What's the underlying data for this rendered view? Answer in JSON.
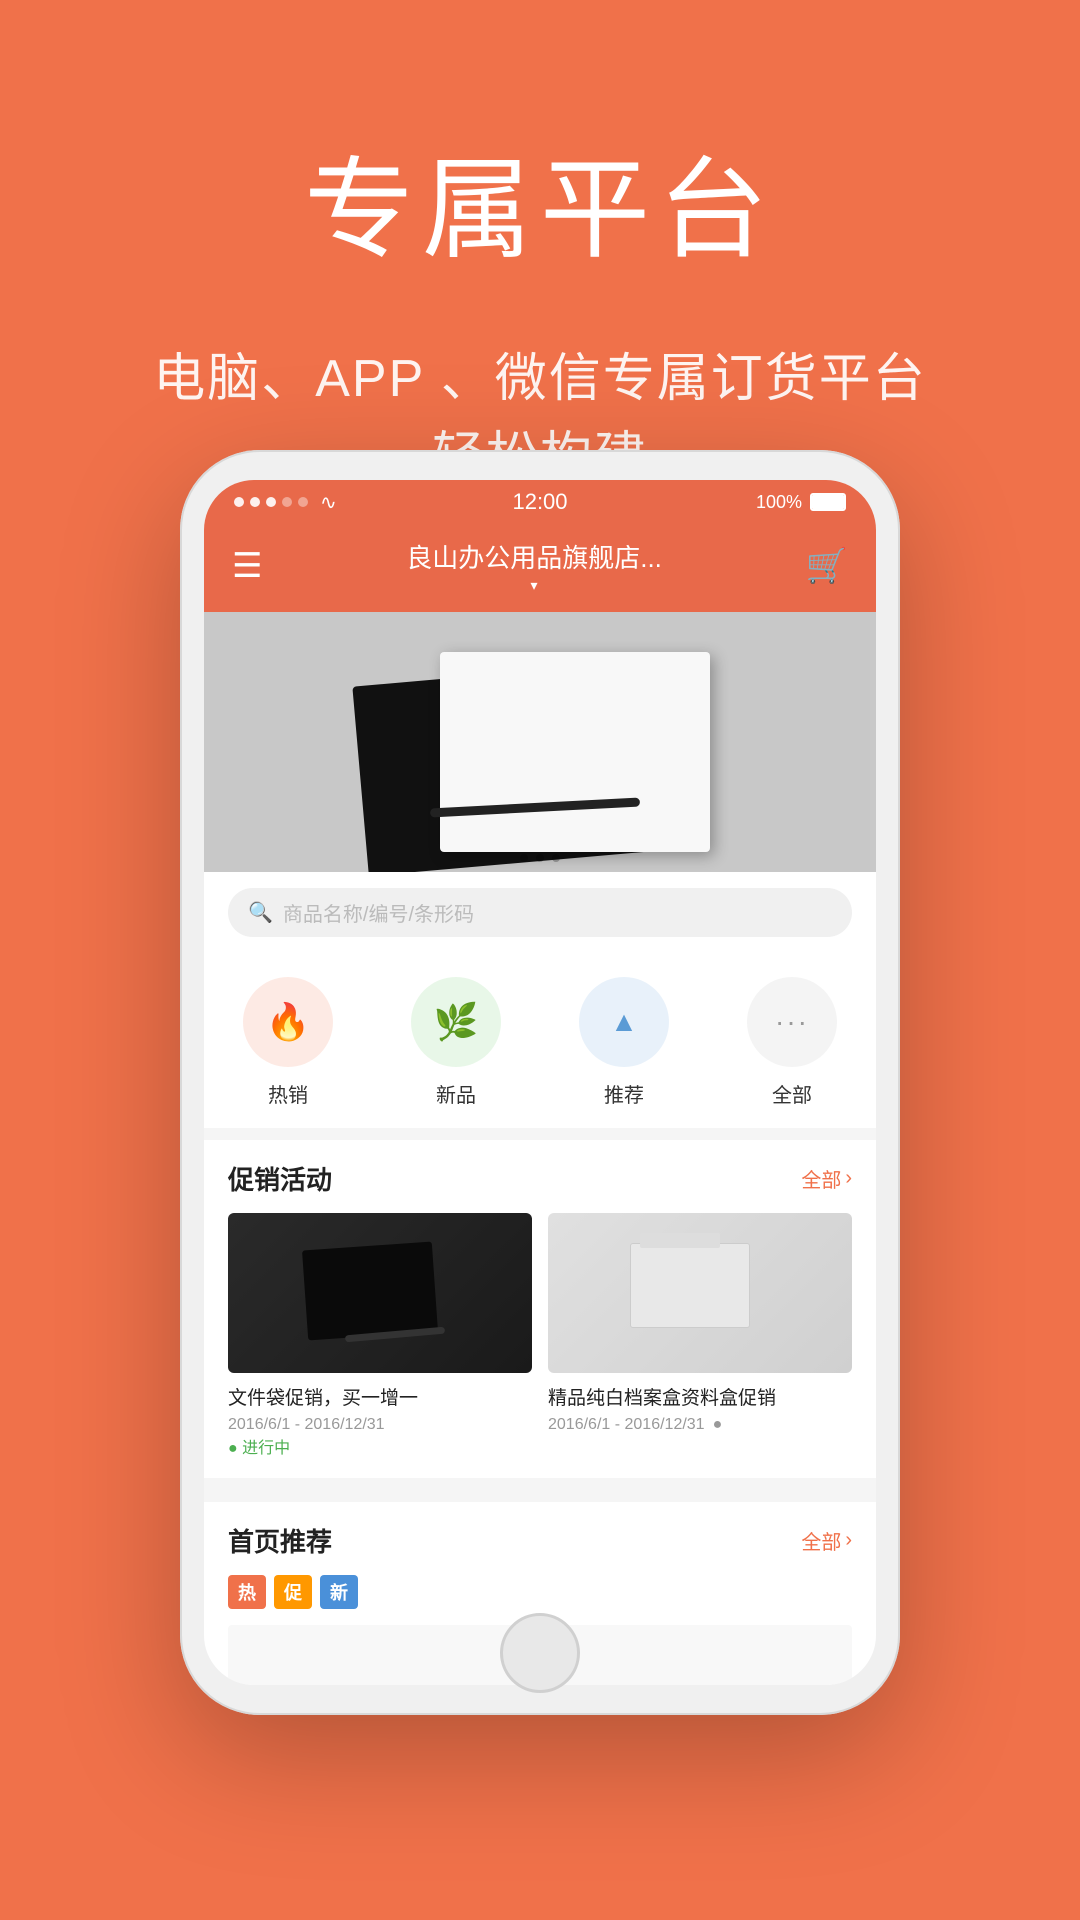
{
  "hero": {
    "title": "专属平台",
    "subtitle_line1": "电脑、APP 、微信专属订货平台",
    "subtitle_line2": "轻松构建"
  },
  "phone": {
    "status_bar": {
      "time": "12:00",
      "battery": "100%",
      "dots": [
        "filled",
        "filled",
        "filled",
        "empty",
        "empty"
      ]
    },
    "nav": {
      "title": "良山办公用品旗舰店...",
      "arrow": "▾"
    },
    "search": {
      "placeholder": "商品名称/编号/条形码"
    },
    "categories": [
      {
        "label": "热销",
        "type": "hot",
        "icon": "🔥"
      },
      {
        "label": "新品",
        "type": "new",
        "icon": "🌿"
      },
      {
        "label": "推荐",
        "type": "rec",
        "icon": "▲"
      },
      {
        "label": "全部",
        "type": "all",
        "icon": "···"
      }
    ],
    "promotions": {
      "title": "促销活动",
      "link": "全部",
      "items": [
        {
          "title": "文件袋促销，买一增一",
          "date": "2016/6/1 - 2016/12/31",
          "status": "● 进行中",
          "img_type": "dark"
        },
        {
          "title": "精品纯白档案盒资料盒促销",
          "date": "2016/6/1 - 2016/12/31",
          "status": "●",
          "img_type": "light"
        }
      ]
    },
    "featured": {
      "title": "首页推荐",
      "link": "全部",
      "badges": [
        "热",
        "促",
        "新"
      ]
    }
  }
}
